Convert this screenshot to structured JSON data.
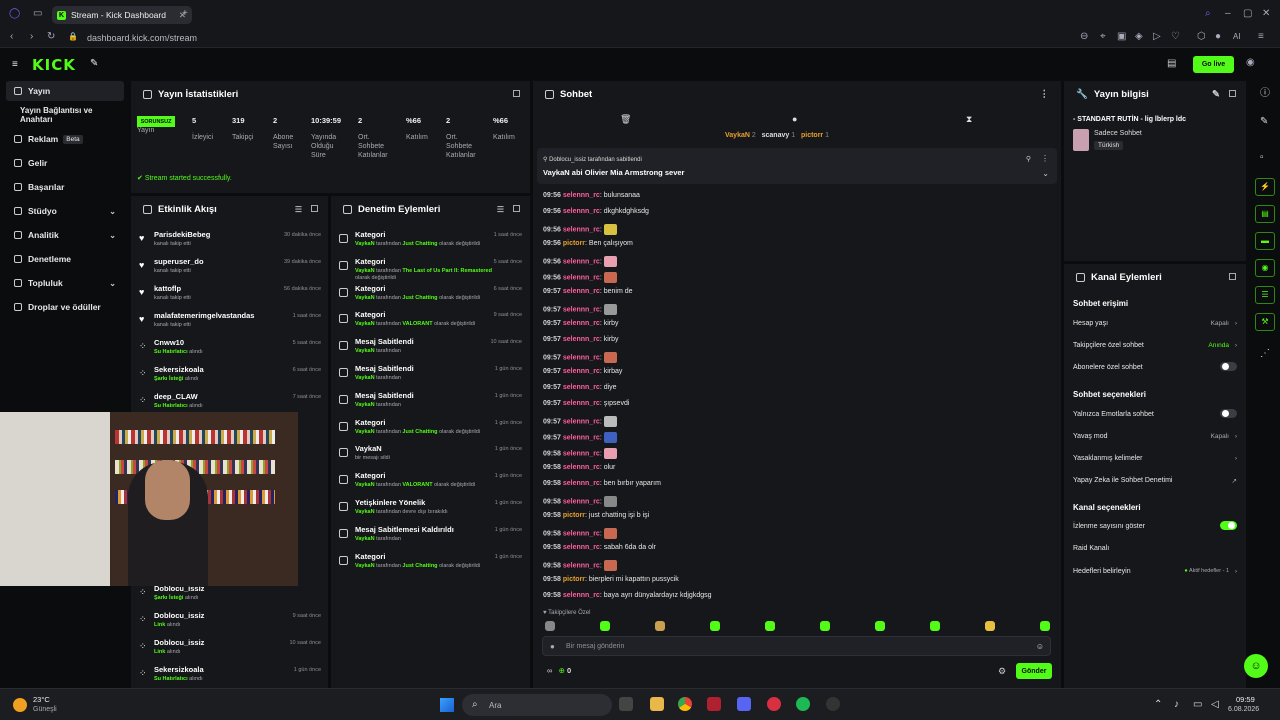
{
  "browser": {
    "tab_title": "Stream - Kick Dashboard",
    "url": "dashboard.kick.com/stream",
    "ai_label": "AI"
  },
  "topbar": {
    "logo": "KICK",
    "go_live": "Go live"
  },
  "sidebar": {
    "items": [
      {
        "label": "Yayın"
      },
      {
        "label": "Yayın Bağlantısı ve Anahtarı"
      },
      {
        "label": "Reklam",
        "badge": "Beta"
      },
      {
        "label": "Gelir"
      },
      {
        "label": "Başarılar"
      },
      {
        "label": "Stüdyo"
      },
      {
        "label": "Analitik"
      },
      {
        "label": "Denetleme"
      },
      {
        "label": "Topluluk"
      },
      {
        "label": "Droplar ve ödüller"
      }
    ]
  },
  "stats": {
    "title": "Yayın İstatistikleri",
    "status_badge": "SORUNSUZ",
    "status_label": "Yayın",
    "items": [
      {
        "value": "5",
        "label": "İzleyici"
      },
      {
        "value": "319",
        "label": "Takipçi"
      },
      {
        "value": "2",
        "label": "Abone Sayısı"
      },
      {
        "value": "10:39:59",
        "label": "Yayında Olduğu Süre"
      },
      {
        "value": "2",
        "label": "Ort. Sohbete Katılanlar"
      },
      {
        "value": "%66",
        "label": "Katılım"
      },
      {
        "value": "2",
        "label": "Ort. Sohbete Katılanlar"
      },
      {
        "value": "%66",
        "label": "Katılım"
      }
    ],
    "message": "Stream started successfully."
  },
  "activity": {
    "title": "Etkinlik Akışı",
    "items": [
      {
        "name": "ParisdekiBebeg",
        "sub": "kanalı takip etti",
        "time": "30 dakika önce"
      },
      {
        "name": "superuser_do",
        "sub": "kanalı takip etti",
        "time": "39 dakika önce"
      },
      {
        "name": "kattoflp",
        "sub": "kanalı takip etti",
        "time": "56 dakika önce"
      },
      {
        "name": "malafatemerimgelvastandas",
        "sub": "kanalı takip etti",
        "time": "1 saat önce"
      },
      {
        "name": "Cnww10",
        "hl": "Su Hatırlatıcı",
        "sub": " alındı",
        "time": "5 saat önce"
      },
      {
        "name": "Sekersizkoala",
        "hl": "Şarkı İsteği",
        "sub": " alındı",
        "time": "6 saat önce"
      },
      {
        "name": "deep_CLAW",
        "hl": "Su Hatırlatıcı",
        "sub": " alındı",
        "time": "7 saat önce"
      },
      {
        "name": "Doblocu_issiz",
        "hl": "Şarkı İsteği",
        "sub": " alındı",
        "time": ""
      },
      {
        "name": "Doblocu_issiz",
        "hl": "Link",
        "sub": " alındı",
        "time": "9 saat önce"
      },
      {
        "name": "Doblocu_issiz",
        "hl": "Link",
        "sub": " alındı",
        "time": "10 saat önce"
      },
      {
        "name": "Sekersizkoala",
        "hl": "Su Hatırlatıcı",
        "sub": " alındı",
        "time": "1 gün önce"
      }
    ]
  },
  "moderation": {
    "title": "Denetim Eylemleri",
    "items": [
      {
        "name": "Kategori",
        "user": "VaykaN",
        "mid": " tarafından ",
        "val": "Just Chatting",
        "end": " olarak değiştirildi",
        "time": "1 saat önce"
      },
      {
        "name": "Kategori",
        "user": "VaykaN",
        "mid": " tarafından ",
        "val": "The Last of Us Part II: Remastered",
        "end": " olarak değiştirildi",
        "time": "5 saat önce"
      },
      {
        "name": "Kategori",
        "user": "VaykaN",
        "mid": " tarafından ",
        "val": "Just Chatting",
        "end": " olarak değiştirildi",
        "time": "6 saat önce"
      },
      {
        "name": "Kategori",
        "user": "VaykaN",
        "mid": " tarafından ",
        "val": "VALORANT",
        "end": " olarak değiştirildi",
        "time": "9 saat önce"
      },
      {
        "name": "Mesaj Sabitlendi",
        "user": "VaykaN",
        "mid": " tarafından",
        "val": "",
        "end": "",
        "time": "10 saat önce"
      },
      {
        "name": "Mesaj Sabitlendi",
        "user": "VaykaN",
        "mid": " tarafından",
        "val": "",
        "end": "",
        "time": "1 gün önce"
      },
      {
        "name": "Mesaj Sabitlendi",
        "user": "VaykaN",
        "mid": " tarafından",
        "val": "",
        "end": "",
        "time": "1 gün önce"
      },
      {
        "name": "Kategori",
        "user": "VaykaN",
        "mid": " tarafından ",
        "val": "Just Chatting",
        "end": " olarak değiştirildi",
        "time": "1 gün önce"
      },
      {
        "name": "VaykaN",
        "user": "",
        "mid": "bir mesajı sildi",
        "val": "",
        "end": "",
        "time": "1 gün önce"
      },
      {
        "name": "Kategori",
        "user": "VaykaN",
        "mid": " tarafından ",
        "val": "VALORANT",
        "end": " olarak değiştirildi",
        "time": "1 gün önce"
      },
      {
        "name": "Yetişkinlere Yönelik",
        "user": "VaykaN",
        "mid": " tarafından devre dışı bırakıldı",
        "val": "",
        "end": "",
        "time": "1 gün önce"
      },
      {
        "name": "Mesaj Sabitlemesi Kaldırıldı",
        "user": "VaykaN",
        "mid": " tarafından",
        "val": "",
        "end": "",
        "time": "1 gün önce"
      },
      {
        "name": "Kategori",
        "user": "VaykaN",
        "mid": " tarafından ",
        "val": "Just Chatting",
        "end": " olarak değiştirildi",
        "time": "1 gün önce"
      }
    ]
  },
  "chat": {
    "title": "Sohbet",
    "top_users": [
      {
        "name": "VaykaN",
        "n": "2"
      },
      {
        "name": "scanavy",
        "n": "1"
      },
      {
        "name": "pictorr",
        "n": "1"
      }
    ],
    "pinned_by": "Doblocu_issiz tarafından sabitlendi",
    "pinned_msg": "VaykaN abi Olivier Mia Armstrong sever",
    "messages": [
      {
        "t": "09:56",
        "u": "selennn_rc",
        "m": "bulunsanaa"
      },
      {
        "t": "09:56",
        "u": "selennn_rc",
        "m": "dkghkdghksdg"
      },
      {
        "t": "09:56",
        "u": "selennn_rc",
        "m": "",
        "emo": "#d8c040"
      },
      {
        "t": "09:56",
        "u": "pictorr",
        "m": "Ben çalışıyom",
        "o": true
      },
      {
        "t": "09:56",
        "u": "selennn_rc",
        "m": "",
        "emo": "#e8a0b0"
      },
      {
        "t": "09:56",
        "u": "selennn_rc",
        "m": "",
        "emo": "#c86850"
      },
      {
        "t": "09:57",
        "u": "selennn_rc",
        "m": "benim de"
      },
      {
        "t": "09:57",
        "u": "selennn_rc",
        "m": "",
        "emo": "#999"
      },
      {
        "t": "09:57",
        "u": "selennn_rc",
        "m": "kirby"
      },
      {
        "t": "09:57",
        "u": "selennn_rc",
        "m": "kirby"
      },
      {
        "t": "09:57",
        "u": "selennn_rc",
        "m": "",
        "emo": "#c86850"
      },
      {
        "t": "09:57",
        "u": "selennn_rc",
        "m": "kirbay"
      },
      {
        "t": "09:57",
        "u": "selennn_rc",
        "m": "diye"
      },
      {
        "t": "09:57",
        "u": "selennn_rc",
        "m": "şıpsevdi"
      },
      {
        "t": "09:57",
        "u": "selennn_rc",
        "m": "",
        "emo": "#bbb"
      },
      {
        "t": "09:57",
        "u": "selennn_rc",
        "m": "",
        "emo": "#4060c0"
      },
      {
        "t": "09:58",
        "u": "selennn_rc",
        "m": "",
        "emo": "#e8a0b0"
      },
      {
        "t": "09:58",
        "u": "selennn_rc",
        "m": "olur"
      },
      {
        "t": "09:58",
        "u": "selennn_rc",
        "m": "ben bırbır yaparım"
      },
      {
        "t": "09:58",
        "u": "selennn_rc",
        "m": "",
        "emo": "#888"
      },
      {
        "t": "09:58",
        "u": "pictorr",
        "m": "just chatting işi b işi",
        "o": true
      },
      {
        "t": "09:58",
        "u": "selennn_rc",
        "m": "",
        "emo": "#c86850"
      },
      {
        "t": "09:58",
        "u": "selennn_rc",
        "m": "sabah 6da da olr"
      },
      {
        "t": "09:58",
        "u": "selennn_rc",
        "m": "",
        "emo": "#c86850"
      },
      {
        "t": "09:58",
        "u": "pictorr",
        "m": "bierpleri mi kapattın pussycik",
        "o": true
      },
      {
        "t": "09:58",
        "u": "selennn_rc",
        "m": "baya ayrı dünyalardayız kdjgkdgsg"
      }
    ],
    "followers_only": "Takipçilere Özel",
    "input_placeholder": "Bir mesaj gönderin",
    "count": "0",
    "send": "Gönder"
  },
  "info": {
    "title": "Yayın bilgisi",
    "stream_title": "- STANDART RUTİN - lig lblerp ldc",
    "category": "Sadece Sohbet",
    "language": "Türkish"
  },
  "channel": {
    "title": "Kanal Eylemleri",
    "sec1": "Sohbet erişimi",
    "age": {
      "label": "Hesap yaşı",
      "value": "Kapalı"
    },
    "followers": {
      "label": "Takipçilere özel sohbet",
      "value": "Anında"
    },
    "subs": {
      "label": "Abonelere özel sohbet"
    },
    "sec2": "Sohbet seçenekleri",
    "emotes": {
      "label": "Yalnızca Emotlarla sohbet"
    },
    "slow": {
      "label": "Yavaş mod",
      "value": "Kapalı"
    },
    "banned": {
      "label": "Yasaklanmış kelimeler"
    },
    "ai": {
      "label": "Yapay Zeka ile Sohbet Denetimi"
    },
    "sec3": "Kanal seçenekleri",
    "viewcount": {
      "label": "İzlenme sayısını göster"
    },
    "raid": {
      "label": "Raid Kanalı"
    },
    "goals": {
      "label": "Hedefleri belirleyin",
      "value": "Aktif hedefler - 1"
    }
  },
  "taskbar": {
    "temp": "23°C",
    "weather": "Güneşli",
    "search": "Ara",
    "time": "09:59",
    "date": "6.08.2026"
  },
  "colors": {
    "accent": "#53fc18",
    "bg": "#0b0c0e",
    "panel": "#16171a"
  }
}
